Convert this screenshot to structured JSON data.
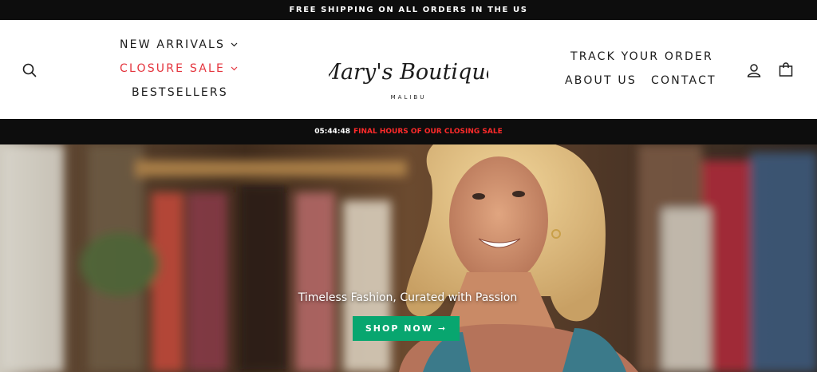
{
  "announcement": "FREE SHIPPING ON ALL ORDERS IN THE US",
  "nav_left": {
    "new_arrivals": "NEW ARRIVALS",
    "closure_sale": "CLOSURE SALE",
    "bestsellers": "BESTSELLERS"
  },
  "logo": {
    "name": "Mary's Boutique",
    "location": "MALIBU"
  },
  "nav_right": {
    "track_order": "TRACK YOUR ORDER",
    "about_us": "ABOUT US",
    "contact": "CONTACT"
  },
  "countdown": {
    "time": "05:44:48",
    "message": "FINAL HOURS OF OUR CLOSING SALE"
  },
  "hero": {
    "title": "Timeless Fashion, Curated with Passion",
    "button_label": "SHOP NOW",
    "button_arrow": "➞"
  },
  "colors": {
    "sale_red": "#e4343d",
    "countdown_red": "#ff2a2a",
    "cta_green": "#08a66f",
    "bar_black": "#0d0d0d"
  },
  "icons": {
    "search": "search-icon",
    "account": "user-icon",
    "cart": "shopping-bag-icon",
    "dropdown": "chevron-down-icon"
  }
}
